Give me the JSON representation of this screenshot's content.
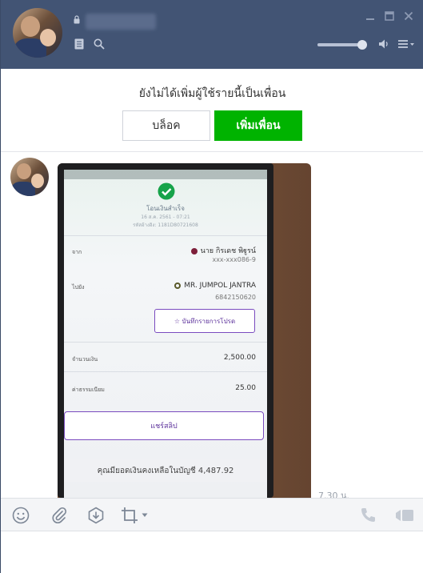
{
  "header": {
    "contact_name": "",
    "icons": {
      "lock": "lock-icon",
      "notes": "notes-icon",
      "search": "search-icon",
      "minimize": "minimize-icon",
      "maximize": "maximize-icon",
      "close": "close-icon",
      "speaker": "speaker-icon",
      "menu": "menu-icon"
    },
    "volume_level": 0.9,
    "colors": {
      "header_bg": "#425474"
    }
  },
  "banner": {
    "message": "ยังไม่ได้เพิ่มผู้ใช้รายนี้เป็นเพื่อน",
    "block_label": "บล็อค",
    "add_friend_label": "เพิ่มเพื่อน",
    "colors": {
      "add_friend_bg": "#00b300"
    }
  },
  "message": {
    "time": "7.30 น.",
    "slip": {
      "title": "โอนเงินสำเร็จ",
      "date": "16 ส.ค. 2561 - 07:21",
      "ref": "รหัสอ้างอิง: 1181D80721608",
      "from_label": "จาก",
      "from_name": "นาย กิรเดช พิฐูรน์",
      "from_account": "xxx-xxx086-9",
      "to_label": "ไปยัง",
      "to_name": "MR. JUMPOL JANTRA",
      "to_account": "6842150620",
      "save_favorite_label": "☆ บันทึกรายการโปรด",
      "amount_label": "จำนวนเงิน",
      "amount_value": "2,500.00",
      "fee_label": "ค่าธรรมเนียม",
      "fee_value": "25.00",
      "share_label": "แชร์สลิป",
      "balance_text": "คุณมียอดเงินคงเหลือในบัญชี 4,487.92"
    }
  },
  "toolbar": {
    "icons": [
      "emoji-icon",
      "attach-icon",
      "keep-icon",
      "crop-icon",
      "call-icon",
      "video-call-icon"
    ]
  },
  "input": {
    "value": "",
    "placeholder": ""
  }
}
